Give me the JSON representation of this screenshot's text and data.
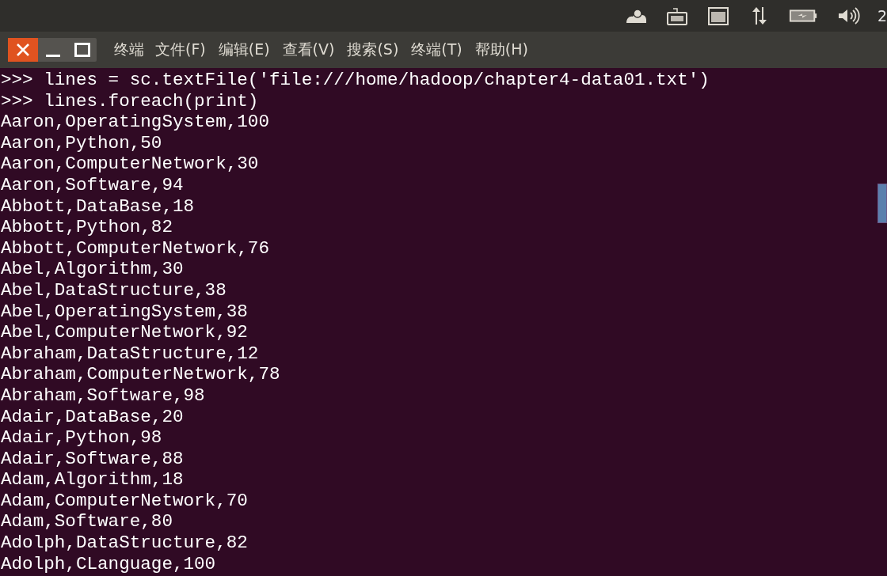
{
  "top_panel": {
    "clock": "2"
  },
  "window": {
    "app_name": "终端",
    "menu": [
      "文件(F)",
      "编辑(E)",
      "查看(V)",
      "搜索(S)",
      "终端(T)",
      "帮助(H)"
    ]
  },
  "terminal": {
    "lines": [
      ">>> lines = sc.textFile('file:///home/hadoop/chapter4-data01.txt')",
      ">>> lines.foreach(print)",
      "Aaron,OperatingSystem,100",
      "Aaron,Python,50",
      "Aaron,ComputerNetwork,30",
      "Aaron,Software,94",
      "Abbott,DataBase,18",
      "Abbott,Python,82",
      "Abbott,ComputerNetwork,76",
      "Abel,Algorithm,30",
      "Abel,DataStructure,38",
      "Abel,OperatingSystem,38",
      "Abel,ComputerNetwork,92",
      "Abraham,DataStructure,12",
      "Abraham,ComputerNetwork,78",
      "Abraham,Software,98",
      "Adair,DataBase,20",
      "Adair,Python,98",
      "Adair,Software,88",
      "Adam,Algorithm,18",
      "Adam,ComputerNetwork,70",
      "Adam,Software,80",
      "Adolph,DataStructure,82",
      "Adolph,CLanguage,100"
    ]
  }
}
